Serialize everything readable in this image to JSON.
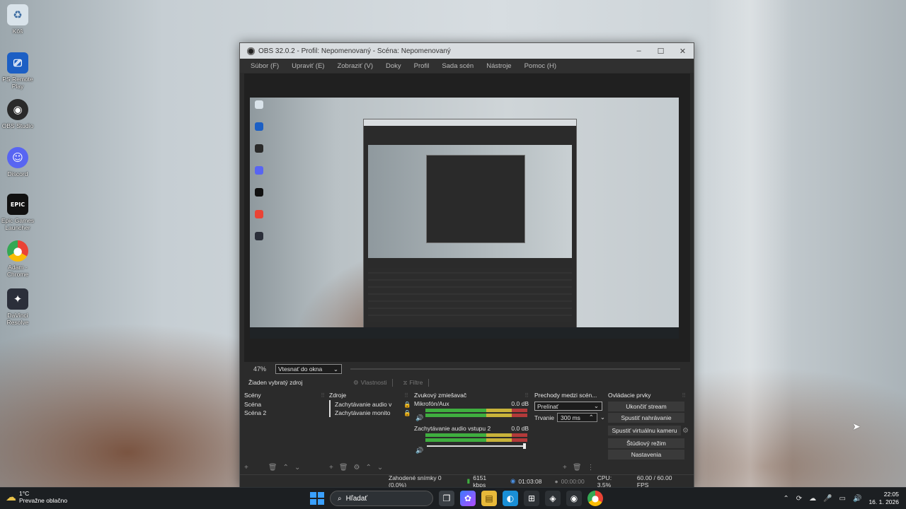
{
  "desktop": {
    "icons": [
      {
        "label": "Kôš",
        "icon": "recycle-bin-icon",
        "color": "#d9e3ea"
      },
      {
        "label": "PS Remote Play",
        "icon": "ps-remote-play-icon",
        "color": "#1c5fc4"
      },
      {
        "label": "OBS Studio",
        "icon": "obs-icon",
        "color": "#2a2a2a"
      },
      {
        "label": "Discord",
        "icon": "discord-icon",
        "color": "#5865f2"
      },
      {
        "label": "Epic Games Launcher",
        "icon": "epic-games-icon",
        "color": "#111111"
      },
      {
        "label": "Adam - Chrome",
        "icon": "chrome-icon",
        "color": "#ea4335"
      },
      {
        "label": "DaVinci Resolve",
        "icon": "davinci-resolve-icon",
        "color": "#2b2f3a"
      }
    ]
  },
  "obs": {
    "title": "OBS 32.0.2 - Profil: Nepomenovaný - Scéna: Nepomenovaný",
    "window_controls": {
      "minimize": "–",
      "maximize": "☐",
      "close": "✕"
    },
    "menu": [
      "Súbor (F)",
      "Upraviť (E)",
      "Zobraziť (V)",
      "Doky",
      "Profil",
      "Sada scén",
      "Nástroje",
      "Pomoc (H)"
    ],
    "zoom": {
      "percent": "47%",
      "mode": "Vtesnať do okna"
    },
    "source_bar": {
      "no_source": "Žiaden vybratý zdroj",
      "properties": "Vlastnosti",
      "filters": "Filtre"
    },
    "scenes": {
      "title": "Scény",
      "items": [
        "Scéna",
        "Scéna 2"
      ]
    },
    "sources": {
      "title": "Zdroje",
      "items": [
        "Zachytávanie audio v",
        "Zachytávanie monito"
      ]
    },
    "mixer": {
      "title": "Zvukový zmiešavač",
      "channels": [
        {
          "name": "Mikrofón/Aux",
          "db": "0.0 dB",
          "level": 0.72
        },
        {
          "name": "Zachytávanie audio vstupu 2",
          "db": "0.0 dB",
          "level": 0.72
        }
      ]
    },
    "transitions": {
      "title": "Prechody medzi scén...",
      "selected": "Prelínať",
      "duration_label": "Trvanie",
      "duration": "300 ms"
    },
    "controls": {
      "title": "Ovládacie prvky",
      "buttons": [
        "Ukončiť stream",
        "Spustiť nahrávanie",
        "Spustiť virtuálnu kameru",
        "Štúdiový režim",
        "Nastavenia"
      ]
    },
    "status": {
      "dropped": "Zahodené snímky 0 (0.0%)",
      "bitrate": "6151 kbps",
      "stream_time": "01:03:08",
      "rec_time": "00:00:00",
      "cpu": "CPU: 3.5%",
      "fps": "60.00 / 60.00 FPS"
    }
  },
  "taskbar": {
    "weather": {
      "temp": "1°C",
      "desc": "Prevažne oblačno"
    },
    "search_placeholder": "Hľadať",
    "clock": {
      "time": "22:05",
      "date": "16. 1. 2026"
    }
  },
  "colors": {
    "meter_green": "#3fae3f",
    "meter_yellow": "#c8b33a",
    "meter_red": "#b33a3a",
    "accent": "#3aa0ff"
  }
}
